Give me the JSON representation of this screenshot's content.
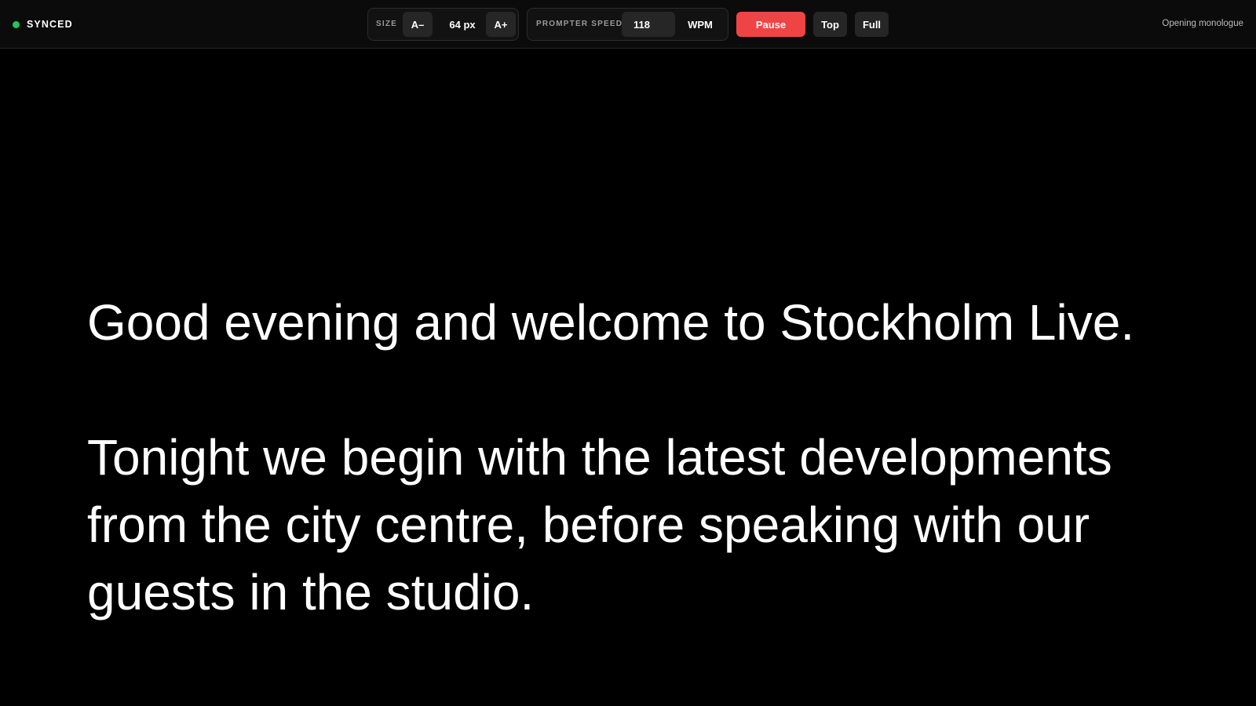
{
  "status": {
    "label": "SYNCED",
    "color": "#22c55e"
  },
  "size_control": {
    "label": "SIZE",
    "decrease_label": "A–",
    "value": "64 px",
    "increase_label": "A+"
  },
  "speed_control": {
    "label": "PROMPTER SPEED",
    "value": "118",
    "unit": "WPM"
  },
  "buttons": {
    "pause": "Pause",
    "top": "Top",
    "full": "Full"
  },
  "script_title": "Opening monologue",
  "colors": {
    "accent_pause": "#ef4444",
    "background": "#000000",
    "text": "#ffffff"
  },
  "script": {
    "paragraphs": [
      "Good evening and welcome to Stockholm Live.",
      "Tonight we begin with the latest developments from the city centre, before speaking with our guests in the studio."
    ]
  }
}
